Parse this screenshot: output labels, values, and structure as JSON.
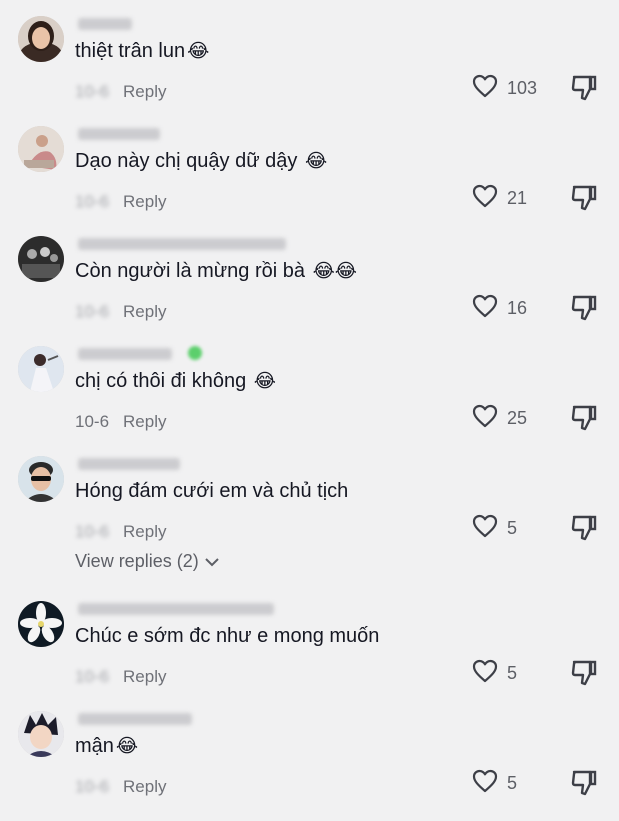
{
  "comments": [
    {
      "text": "thiệt trân lun",
      "emoji": "😂",
      "date": "10-6",
      "reply_label": "Reply",
      "likes": "103",
      "avatar": "woman-portrait"
    },
    {
      "text": "Dạo này chị quậy dữ dậy ",
      "emoji": "😂",
      "date": "10-6",
      "reply_label": "Reply",
      "likes": "21",
      "avatar": "woman-sitting"
    },
    {
      "text": "Còn người là mừng rồi bà ",
      "emoji": "😂😂",
      "date": "10-6",
      "reply_label": "Reply",
      "likes": "16",
      "avatar": "group-photo"
    },
    {
      "text": "chị có thôi đi không ",
      "emoji": "😂",
      "date": "10-6",
      "reply_label": "Reply",
      "likes": "25",
      "avatar": "woman-dress"
    },
    {
      "text": "Hóng đám cưới em và chủ tịch",
      "emoji": "",
      "date": "10-6",
      "reply_label": "Reply",
      "likes": "5",
      "avatar": "man-sunglasses"
    },
    {
      "text": "Chúc e sớm đc như e mong muốn",
      "emoji": "",
      "date": "10-6",
      "reply_label": "Reply",
      "likes": "5",
      "avatar": "white-flower"
    },
    {
      "text": "mận",
      "emoji": "😂",
      "date": "10-6",
      "reply_label": "Reply",
      "likes": "5",
      "avatar": "anime-character"
    }
  ],
  "view_replies": "View replies (2)",
  "icons": {
    "like": "heart-outline-icon",
    "dislike": "thumbs-down-icon",
    "expand": "chevron-down-icon"
  },
  "colors": {
    "background": "#f1f1f2",
    "text": "#161823",
    "secondary": "#6f7178"
  }
}
